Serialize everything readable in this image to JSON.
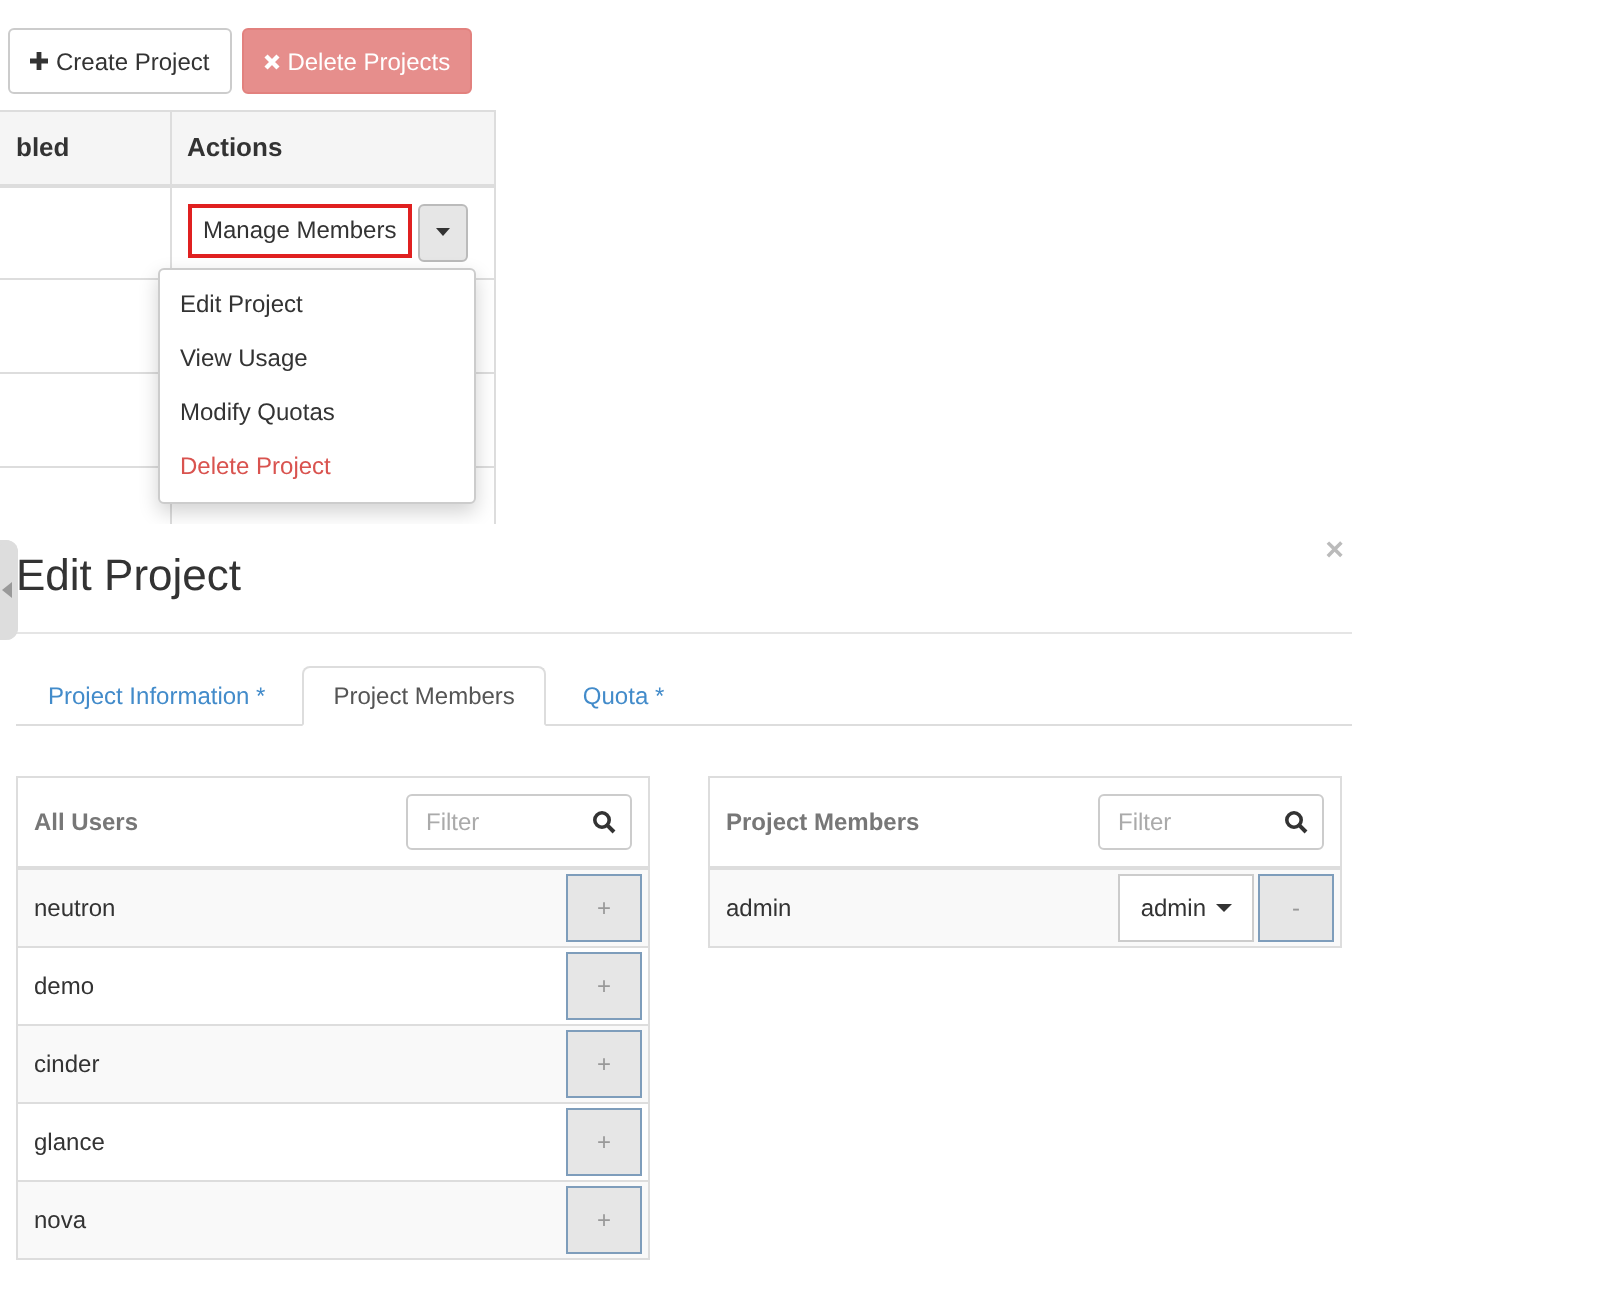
{
  "toolbar": {
    "buttons": [
      {
        "label": "Create Project",
        "kind": "create",
        "disabled": false
      },
      {
        "label": "Delete Projects",
        "kind": "delete",
        "disabled": true
      }
    ]
  },
  "table": {
    "columns": [
      "bled",
      "Actions"
    ],
    "rows": [
      {
        "action": "Manage Members",
        "highlighted": true
      }
    ]
  },
  "action_menu": {
    "items": [
      {
        "label": "Edit Project",
        "kind": "normal"
      },
      {
        "label": "View Usage",
        "kind": "normal"
      },
      {
        "label": "Modify Quotas",
        "kind": "normal"
      },
      {
        "label": "Delete Project",
        "kind": "danger"
      }
    ]
  },
  "dialog": {
    "title": "Edit Project",
    "close": "×",
    "tabs": [
      {
        "label": "Project Information *",
        "selected": false
      },
      {
        "label": "Project Members",
        "selected": true
      },
      {
        "label": "Quota *",
        "selected": false
      }
    ],
    "all_users": {
      "title": "All Users",
      "filter_placeholder": "Filter",
      "users": [
        {
          "name": "neutron",
          "button": "+"
        },
        {
          "name": "demo",
          "button": "+"
        },
        {
          "name": "cinder",
          "button": "+"
        },
        {
          "name": "glance",
          "button": "+"
        },
        {
          "name": "nova",
          "button": "+"
        }
      ]
    },
    "project_members": {
      "title": "Project Members",
      "filter_placeholder": "Filter",
      "members": [
        {
          "name": "admin",
          "role": "admin",
          "button": "-"
        }
      ]
    }
  }
}
